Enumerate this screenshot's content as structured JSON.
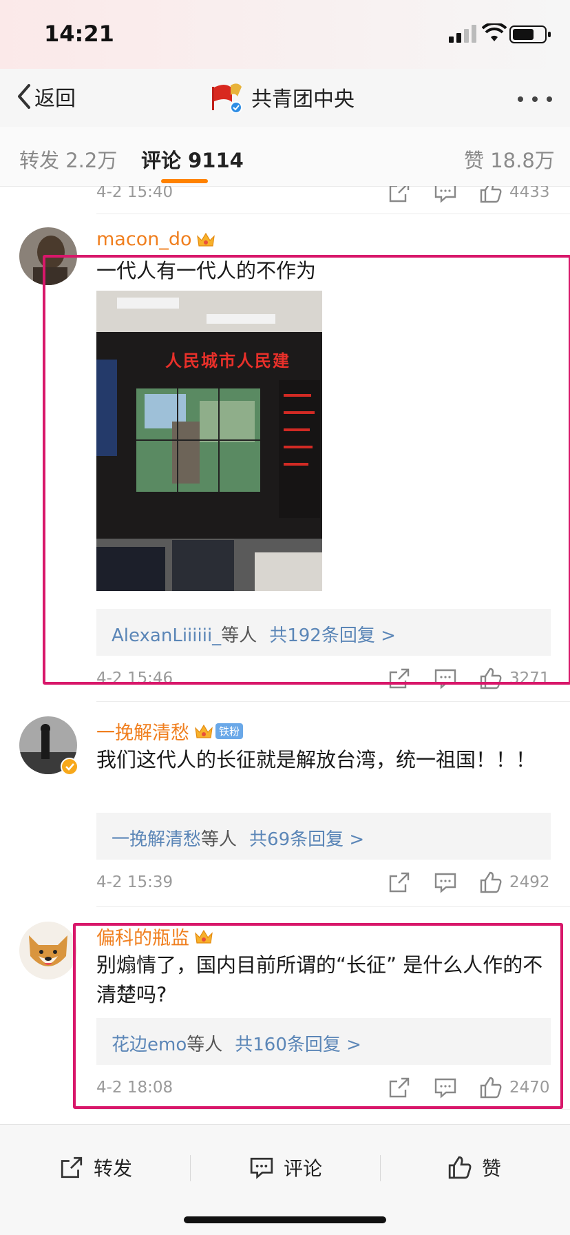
{
  "status_bar": {
    "time": "14:21"
  },
  "nav": {
    "back_label": "返回",
    "title": "共青团中央"
  },
  "tabs": {
    "repost": "转发 2.2万",
    "comment": "评论 9114",
    "like": "赞 18.8万"
  },
  "partial_comment": {
    "time": "4-2 15:40",
    "likes": "4433"
  },
  "comments": [
    {
      "username": "macon_do",
      "text": "一代人有一代人的不作为",
      "image_overlay_text": "人民城市人民建",
      "reply_user": "AlexanLiiiiii_",
      "reply_etc": "等人",
      "reply_count": "共192条回复 >",
      "time": "4-2 15:46",
      "likes": "3271"
    },
    {
      "username": "一挽解清愁",
      "badge": "铁粉",
      "text": "我们这代人的长征就是解放台湾，统一祖国！！！",
      "reply_user": "一挽解清愁",
      "reply_etc": "等人",
      "reply_count": "共69条回复 >",
      "time": "4-2 15:39",
      "likes": "2492"
    },
    {
      "username": "偏科的瓶监",
      "text": "别煽情了，国内目前所谓的“长征” 是什么人作的不清楚吗?",
      "reply_user": "花边emo",
      "reply_etc": "等人",
      "reply_count": "共160条回复 >",
      "time": "4-2 18:08",
      "likes": "2470"
    }
  ],
  "toolbar": {
    "repost": "转发",
    "comment": "评论",
    "like": "赞"
  },
  "colors": {
    "accent": "#ff8200",
    "username": "#f07f1f",
    "link": "#5b86b7",
    "highlight": "#d8176a"
  },
  "icons": [
    "back-chevron-icon",
    "more-icon",
    "share-icon",
    "comment-icon",
    "like-icon",
    "crown-icon",
    "verified-icon"
  ]
}
